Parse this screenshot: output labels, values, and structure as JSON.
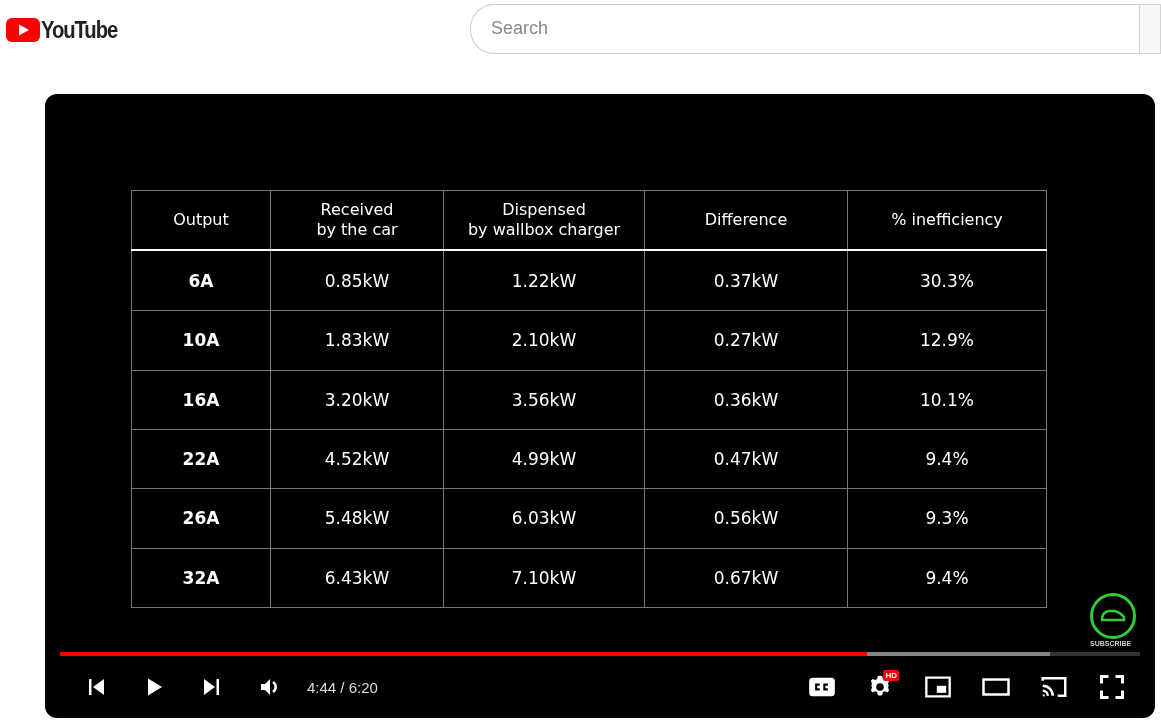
{
  "header": {
    "logo_text": "YouTube",
    "search": {
      "placeholder": "Search"
    }
  },
  "player": {
    "table": {
      "columns": [
        "Output",
        "Received\nby the car",
        "Dispensed\nby wallbox charger",
        "Difference",
        "% inefficiency"
      ],
      "rows": [
        [
          "6A",
          "0.85kW",
          "1.22kW",
          "0.37kW",
          "30.3%"
        ],
        [
          "10A",
          "1.83kW",
          "2.10kW",
          "0.27kW",
          "12.9%"
        ],
        [
          "16A",
          "3.20kW",
          "3.56kW",
          "0.36kW",
          "10.1%"
        ],
        [
          "22A",
          "4.52kW",
          "4.99kW",
          "0.47kW",
          "9.4%"
        ],
        [
          "26A",
          "5.48kW",
          "6.03kW",
          "0.56kW",
          "9.3%"
        ],
        [
          "32A",
          "6.43kW",
          "7.10kW",
          "0.67kW",
          "9.4%"
        ]
      ]
    },
    "subscribe_label": "SUBSCRIBE",
    "progress": {
      "level": 0.747
    },
    "buffer": {
      "level": 0.917
    },
    "time": "4:44 / 6:20",
    "quality_badge": "HD"
  }
}
